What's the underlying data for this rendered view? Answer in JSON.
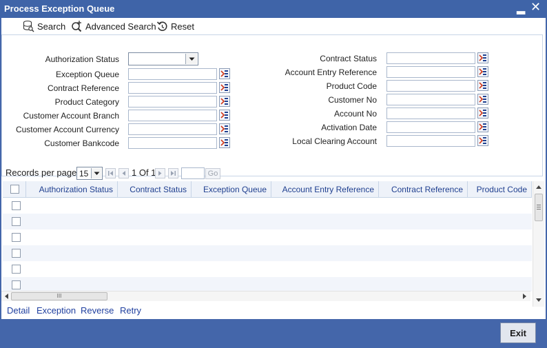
{
  "window": {
    "title": "Process Exception Queue",
    "minimize_glyph": "▂",
    "close_glyph": "✕"
  },
  "toolbar": {
    "search_label": "Search",
    "advanced_search_label": "Advanced Search",
    "reset_label": "Reset"
  },
  "criteria": {
    "left": [
      {
        "label": "Authorization Status",
        "type": "select",
        "value": ""
      },
      {
        "label": "Exception Queue",
        "type": "lov",
        "value": ""
      },
      {
        "label": "Contract Reference",
        "type": "lov",
        "value": ""
      },
      {
        "label": "Product Category",
        "type": "lov",
        "value": ""
      },
      {
        "label": "Customer Account Branch",
        "type": "lov",
        "value": ""
      },
      {
        "label": "Customer Account Currency",
        "type": "lov",
        "value": ""
      },
      {
        "label": "Customer Bankcode",
        "type": "lov",
        "value": ""
      }
    ],
    "right": [
      {
        "label": "Contract Status",
        "type": "lov",
        "value": ""
      },
      {
        "label": "Account Entry Reference",
        "type": "lov",
        "value": ""
      },
      {
        "label": "Product Code",
        "type": "lov",
        "value": ""
      },
      {
        "label": "Customer No",
        "type": "lov",
        "value": ""
      },
      {
        "label": "Account No",
        "type": "lov",
        "value": ""
      },
      {
        "label": "Activation Date",
        "type": "lov",
        "value": ""
      },
      {
        "label": "Local Clearing Account",
        "type": "lov",
        "value": ""
      }
    ]
  },
  "pager": {
    "records_label": "Records per page",
    "records_value": "15",
    "page_text": "1 Of 1",
    "go_label": "Go"
  },
  "grid": {
    "columns": [
      "Authorization Status",
      "Contract Status",
      "Exception Queue",
      "Account Entry Reference",
      "Contract Reference",
      "Product Code"
    ],
    "hscroll_grip": "III"
  },
  "actions": {
    "detail": "Detail",
    "exception": "Exception",
    "reverse": "Reverse",
    "retry": "Retry"
  },
  "footer": {
    "exit_label": "Exit"
  },
  "colors": {
    "titlebar": "#3f64a8",
    "frame": "#4466aa",
    "header_text": "#1f3f8f",
    "link": "#1f3f9f"
  }
}
